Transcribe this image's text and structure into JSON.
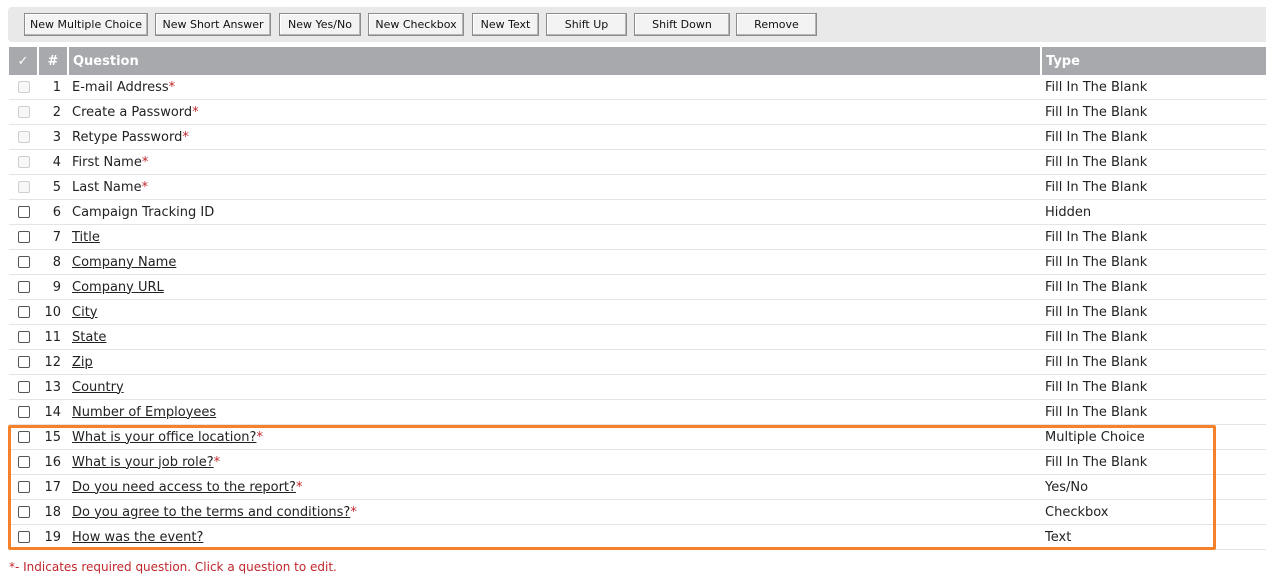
{
  "toolbar": {
    "buttons": [
      {
        "label": "New Multiple Choice"
      },
      {
        "label": "New Short Answer"
      },
      {
        "label": "New Yes/No"
      },
      {
        "label": "New Checkbox"
      },
      {
        "label": "New Text"
      },
      {
        "label": "Shift Up"
      },
      {
        "label": "Shift Down"
      },
      {
        "label": "Remove"
      }
    ]
  },
  "table": {
    "headers": {
      "check": "✓",
      "num": "#",
      "question": "Question",
      "type": "Type"
    },
    "rows": [
      {
        "num": "1",
        "question": "E-mail Address",
        "required": true,
        "linked": false,
        "checkbox_enabled": false,
        "type": "Fill In The Blank"
      },
      {
        "num": "2",
        "question": "Create a Password",
        "required": true,
        "linked": false,
        "checkbox_enabled": false,
        "type": "Fill In The Blank"
      },
      {
        "num": "3",
        "question": "Retype Password",
        "required": true,
        "linked": false,
        "checkbox_enabled": false,
        "type": "Fill In The Blank"
      },
      {
        "num": "4",
        "question": "First Name",
        "required": true,
        "linked": false,
        "checkbox_enabled": false,
        "type": "Fill In The Blank"
      },
      {
        "num": "5",
        "question": "Last Name",
        "required": true,
        "linked": false,
        "checkbox_enabled": false,
        "type": "Fill In The Blank"
      },
      {
        "num": "6",
        "question": "Campaign Tracking ID",
        "required": false,
        "linked": false,
        "checkbox_enabled": true,
        "type": "Hidden"
      },
      {
        "num": "7",
        "question": "Title",
        "required": false,
        "linked": true,
        "checkbox_enabled": true,
        "type": "Fill In The Blank"
      },
      {
        "num": "8",
        "question": "Company Name",
        "required": false,
        "linked": true,
        "checkbox_enabled": true,
        "type": "Fill In The Blank"
      },
      {
        "num": "9",
        "question": "Company URL",
        "required": false,
        "linked": true,
        "checkbox_enabled": true,
        "type": "Fill In The Blank"
      },
      {
        "num": "10",
        "question": "City",
        "required": false,
        "linked": true,
        "checkbox_enabled": true,
        "type": "Fill In The Blank"
      },
      {
        "num": "11",
        "question": "State",
        "required": false,
        "linked": true,
        "checkbox_enabled": true,
        "type": "Fill In The Blank"
      },
      {
        "num": "12",
        "question": "Zip",
        "required": false,
        "linked": true,
        "checkbox_enabled": true,
        "type": "Fill In The Blank"
      },
      {
        "num": "13",
        "question": "Country",
        "required": false,
        "linked": true,
        "checkbox_enabled": true,
        "type": "Fill In The Blank"
      },
      {
        "num": "14",
        "question": "Number of Employees",
        "required": false,
        "linked": true,
        "checkbox_enabled": true,
        "type": "Fill In The Blank"
      },
      {
        "num": "15",
        "question": "What is your office location?",
        "required": true,
        "linked": true,
        "checkbox_enabled": true,
        "type": "Multiple Choice"
      },
      {
        "num": "16",
        "question": "What is your job role?",
        "required": true,
        "linked": true,
        "checkbox_enabled": true,
        "type": "Fill In The Blank"
      },
      {
        "num": "17",
        "question": "Do you need access to the report?",
        "required": true,
        "linked": true,
        "checkbox_enabled": true,
        "type": "Yes/No"
      },
      {
        "num": "18",
        "question": "Do you agree to the terms and conditions?",
        "required": true,
        "linked": true,
        "checkbox_enabled": true,
        "type": "Checkbox"
      },
      {
        "num": "19",
        "question": "How was the event?",
        "required": false,
        "linked": true,
        "checkbox_enabled": true,
        "type": "Text"
      }
    ],
    "required_marker": "*"
  },
  "footer": {
    "note": "*- Indicates required question. Click a question to edit."
  },
  "colors": {
    "header_bg": "#a7a9ac",
    "required": "#c0272d",
    "highlight": "#f5822a"
  }
}
